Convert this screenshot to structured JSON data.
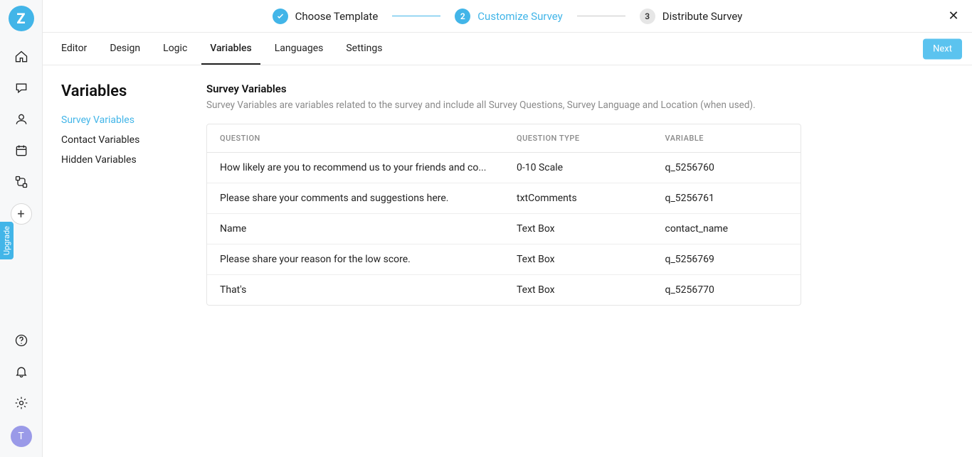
{
  "brand": {
    "logo_initial": "Z"
  },
  "left_rail": {
    "upgrade_label": "Upgrade",
    "avatar_initial": "T"
  },
  "wizard": {
    "steps": [
      {
        "label": "Choose Template"
      },
      {
        "label": "Customize Survey"
      },
      {
        "label": "Distribute Survey"
      }
    ],
    "step2_num": "2",
    "step3_num": "3"
  },
  "subnav": {
    "tabs": [
      {
        "label": "Editor"
      },
      {
        "label": "Design"
      },
      {
        "label": "Logic"
      },
      {
        "label": "Variables"
      },
      {
        "label": "Languages"
      },
      {
        "label": "Settings"
      }
    ],
    "next_label": "Next"
  },
  "sidemenu": {
    "title": "Variables",
    "items": [
      {
        "label": "Survey Variables"
      },
      {
        "label": "Contact Variables"
      },
      {
        "label": "Hidden Variables"
      }
    ]
  },
  "pane": {
    "title": "Survey Variables",
    "description": "Survey Variables are variables related to the survey and include all Survey Questions, Survey Language and Location (when used).",
    "columns": {
      "q": "QUESTION",
      "t": "QUESTION TYPE",
      "v": "VARIABLE"
    },
    "rows": [
      {
        "question": "How likely are you to recommend us to your friends and co...",
        "type": "0-10 Scale",
        "variable": "q_5256760"
      },
      {
        "question": "Please share your comments and suggestions here.",
        "type": "txtComments",
        "variable": "q_5256761"
      },
      {
        "question": "Name",
        "type": "Text Box",
        "variable": "contact_name"
      },
      {
        "question": "Please share your reason for the low score.",
        "type": "Text Box",
        "variable": "q_5256769"
      },
      {
        "question": "That's",
        "type": "Text Box",
        "variable": "q_5256770"
      }
    ]
  }
}
